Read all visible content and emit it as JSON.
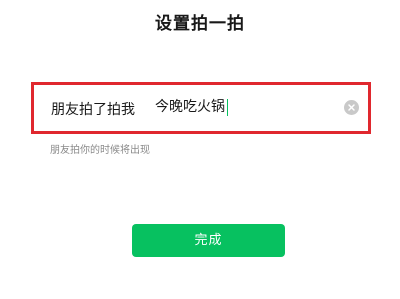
{
  "header": {
    "title": "设置拍一拍"
  },
  "pat_field": {
    "prefix": "朋友拍了拍我",
    "value": "今晚吃火锅",
    "clear_icon": "clear-circle-icon"
  },
  "hint": "朋友拍你的时候将出现",
  "actions": {
    "done_label": "完成"
  },
  "colors": {
    "accent": "#07c160",
    "highlight_border": "#e0282e",
    "hint": "#8a8a8a"
  }
}
